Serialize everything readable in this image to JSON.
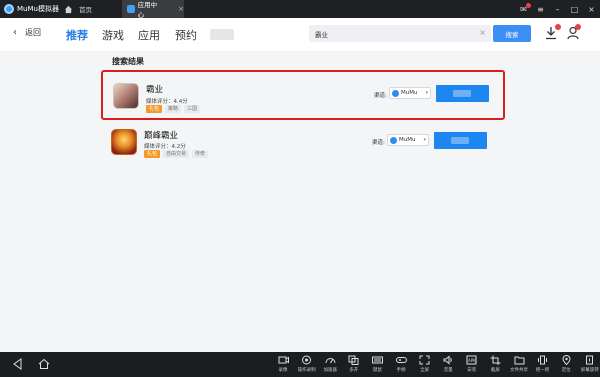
{
  "titlebar": {
    "app_name": "MuMu模拟器",
    "tabs": [
      {
        "label": "首页"
      },
      {
        "label": "应用中心"
      }
    ]
  },
  "header": {
    "back_label": "返回",
    "nav_tabs": [
      {
        "label": "推荐"
      },
      {
        "label": "游戏"
      },
      {
        "label": "应用"
      },
      {
        "label": "预约"
      }
    ],
    "search": {
      "value": "霸业",
      "clear_icon": "×",
      "button_label": "搜索"
    }
  },
  "main": {
    "section_title": "搜索结果",
    "results": [
      {
        "name": "霸业",
        "rating": "媒体评分：4.4分",
        "tags": [
          "礼包",
          "策略",
          "三国"
        ],
        "channel_label": "渠道:",
        "channel": "MuMu"
      },
      {
        "name": "巅峰霸业",
        "rating": "媒体评分：4.2分",
        "tags": [
          "礼包",
          "自由交易",
          "传奇"
        ],
        "channel_label": "渠道:",
        "channel": "MuMu"
      }
    ]
  },
  "bottombar": {
    "tools": [
      {
        "label": "录像",
        "icon": "video-icon"
      },
      {
        "label": "操作录制",
        "icon": "macro-icon"
      },
      {
        "label": "加速器",
        "icon": "speed-icon"
      },
      {
        "label": "多开",
        "icon": "multi-instance-icon"
      },
      {
        "label": "键鼠",
        "icon": "keyboard-icon"
      },
      {
        "label": "手柄",
        "icon": "gamepad-icon"
      },
      {
        "label": "全屏",
        "icon": "fullscreen-icon"
      },
      {
        "label": "音量",
        "icon": "volume-icon"
      },
      {
        "label": "安装",
        "icon": "apk-icon"
      },
      {
        "label": "截屏",
        "icon": "crop-icon"
      },
      {
        "label": "文件共享",
        "icon": "folder-icon"
      },
      {
        "label": "摇一摇",
        "icon": "shake-icon"
      },
      {
        "label": "定位",
        "icon": "location-icon"
      },
      {
        "label": "屏幕旋转",
        "icon": "rotate-icon"
      }
    ]
  },
  "colors": {
    "accent": "#2b7de9",
    "install_button": "#1e86f0",
    "highlight_border": "#d71f1f",
    "tag_orange": "#f39a2b"
  }
}
